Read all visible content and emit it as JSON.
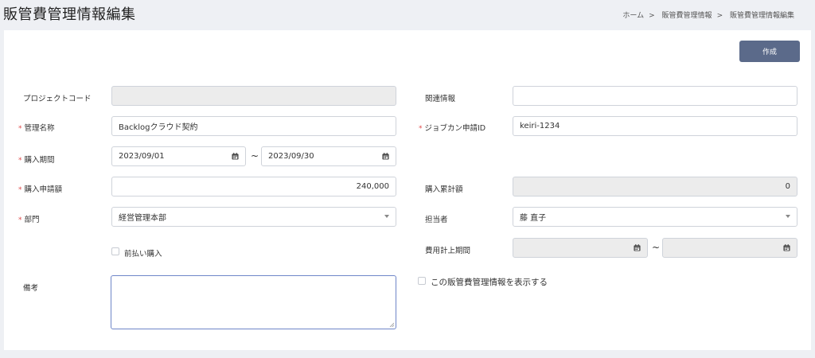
{
  "header": {
    "title": "販管費管理情報編集",
    "breadcrumb": [
      "ホーム",
      "販管費管理情報",
      "販管費管理情報編集"
    ],
    "breadcrumb_sep": ">"
  },
  "toolbar": {
    "create_label": "作成"
  },
  "form": {
    "project_code": {
      "label": "プロジェクトコード",
      "value": ""
    },
    "related_info": {
      "label": "関連情報",
      "value": ""
    },
    "management_name": {
      "label": "管理名称",
      "value": "Backlogクラウド契約"
    },
    "jobcan_id": {
      "label": "ジョブカン申請ID",
      "value": "keiri-1234"
    },
    "purchase_period": {
      "label": "購入期間",
      "from": "2023/09/01",
      "to": "2023/09/30",
      "separator": "~"
    },
    "purchase_amount": {
      "label": "購入申請額",
      "value": "240,000"
    },
    "cumulative_amount": {
      "label": "購入累計額",
      "value": "0"
    },
    "department": {
      "label": "部門",
      "value": "経営管理本部"
    },
    "person_in_charge": {
      "label": "担当者",
      "value": "藤 直子"
    },
    "prepaid": {
      "label": "前払い購入"
    },
    "expense_period": {
      "label": "費用計上期間",
      "from": "",
      "to": "",
      "separator": "~"
    },
    "remarks": {
      "label": "備考",
      "value": ""
    },
    "show_info": {
      "label": "この販管費管理情報を表示する"
    }
  },
  "required_mark": "*",
  "colors": {
    "primary_button": "#5b6a8a",
    "required": "#e04b4b",
    "focus_border": "#6f86c8"
  }
}
